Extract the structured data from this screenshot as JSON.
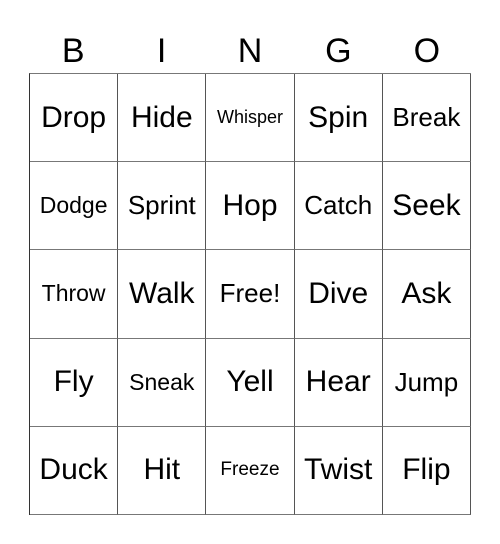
{
  "header": [
    "B",
    "I",
    "N",
    "G",
    "O"
  ],
  "cells": [
    [
      "Drop",
      "Hide",
      "Whisper",
      "Spin",
      "Break"
    ],
    [
      "Dodge",
      "Sprint",
      "Hop",
      "Catch",
      "Seek"
    ],
    [
      "Throw",
      "Walk",
      "Free!",
      "Dive",
      "Ask"
    ],
    [
      "Fly",
      "Sneak",
      "Yell",
      "Hear",
      "Jump"
    ],
    [
      "Duck",
      "Hit",
      "Freeze",
      "Twist",
      "Flip"
    ]
  ]
}
